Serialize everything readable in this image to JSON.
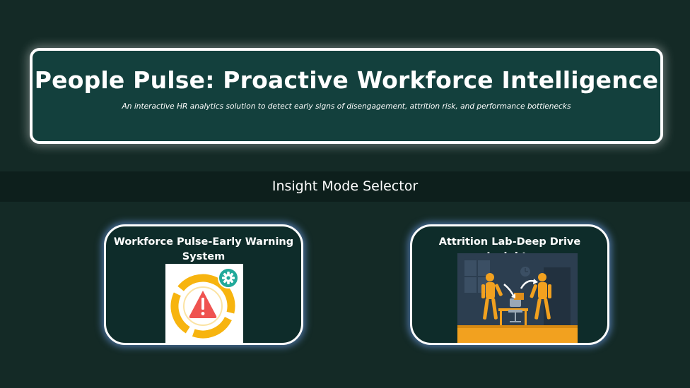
{
  "header": {
    "title": "People Pulse: Proactive Workforce Intelligence",
    "subtitle": "An interactive HR analytics solution to detect early signs of disengagement, attrition risk, and performance bottlenecks"
  },
  "mode_selector": {
    "label": "Insight Mode Selector"
  },
  "modes": [
    {
      "title": "Workforce Pulse-Early Warning System",
      "icon": "early-warning-icon"
    },
    {
      "title": "Attrition Lab-Deep Drive Insights",
      "icon": "attrition-illustration"
    }
  ],
  "colors": {
    "background": "#142a26",
    "header_card": "#13403d",
    "mode_bar": "#0d1f1c",
    "card_glow": "#78aaff",
    "warning_ring": "#f7b40f",
    "warning_triangle": "#ef5350",
    "gear_badge": "#21a99a",
    "attrition_floor": "#f2a11f"
  }
}
